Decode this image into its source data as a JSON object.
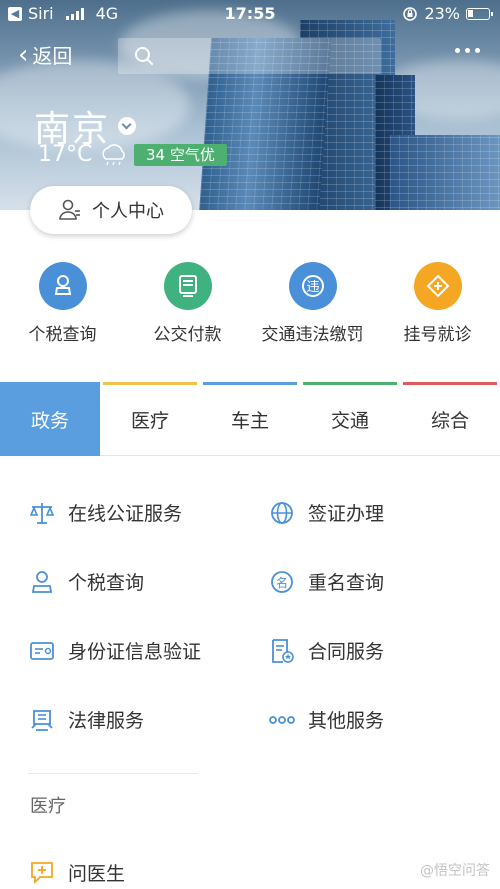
{
  "status_bar": {
    "carrier": "Siri",
    "network": "4G",
    "time": "17:55",
    "battery": "23%"
  },
  "nav": {
    "back_label": "返回"
  },
  "city": {
    "name": "南京",
    "temperature": "17°C",
    "aqi": "34 空气优"
  },
  "personal_center": "个人中心",
  "quick_services": [
    {
      "label": "个税查询",
      "icon": "person-tax-icon",
      "color": "#4a90d9"
    },
    {
      "label": "公交付款",
      "icon": "bus-card-icon",
      "color": "#3fb27f"
    },
    {
      "label": "交通违法缴罚",
      "icon": "traffic-violation-icon",
      "color": "#4a90d9"
    },
    {
      "label": "挂号就诊",
      "icon": "medical-cross-icon",
      "color": "#f5a623"
    }
  ],
  "tabs": [
    {
      "label": "政务",
      "color": "#5b9ee0"
    },
    {
      "label": "医疗",
      "color": "#f2c14e"
    },
    {
      "label": "车主",
      "color": "#5b9ee0"
    },
    {
      "label": "交通",
      "color": "#4db071"
    },
    {
      "label": "综合",
      "color": "#e05b5b"
    }
  ],
  "services": [
    {
      "label": "在线公证服务",
      "icon": "scales-icon"
    },
    {
      "label": "签证办理",
      "icon": "globe-icon"
    },
    {
      "label": "个税查询",
      "icon": "person-stamp-icon"
    },
    {
      "label": "重名查询",
      "icon": "name-tag-icon"
    },
    {
      "label": "身份证信息验证",
      "icon": "id-card-icon"
    },
    {
      "label": "合同服务",
      "icon": "contract-icon"
    },
    {
      "label": "法律服务",
      "icon": "court-icon"
    },
    {
      "label": "其他服务",
      "icon": "more-dots-icon"
    }
  ],
  "medical_section": {
    "title": "医疗",
    "first_item": "问医生"
  },
  "watermark": "@悟空问答"
}
